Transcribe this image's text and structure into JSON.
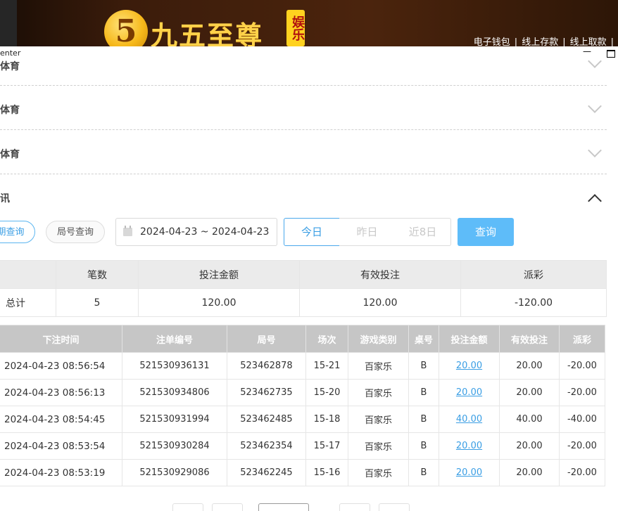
{
  "banner": {
    "logo_glyph": "5",
    "logo_text": "九五至尊",
    "logo_tag": "娱乐",
    "links": [
      "电子钱包",
      "线上存款",
      "线上取款"
    ],
    "separator": "|"
  },
  "window": {
    "title": "enter",
    "minimize_glyph": "—"
  },
  "accordion": [
    {
      "label": "体育",
      "expanded": false
    },
    {
      "label": "体育",
      "expanded": false
    },
    {
      "label": "体育",
      "expanded": false
    },
    {
      "label": "讯",
      "expanded": true
    }
  ],
  "query": {
    "mode_date": "期查询",
    "mode_round": "局号查询",
    "date_range": "2024-04-23 ~ 2024-04-23",
    "today": "今日",
    "yesterday": "昨日",
    "last8": "近8日",
    "submit": "查询"
  },
  "summary": {
    "headers": [
      "",
      "笔数",
      "投注金额",
      "有效投注",
      "派彩"
    ],
    "row": [
      "总计",
      "5",
      "120.00",
      "120.00",
      "-120.00"
    ]
  },
  "details": {
    "headers": [
      "下注时间",
      "注单编号",
      "局号",
      "场次",
      "游戏类别",
      "桌号",
      "投注金额",
      "有效投注",
      "派彩"
    ],
    "rows": [
      [
        "2024-04-23 08:56:54",
        "521530936131",
        "523462878",
        "15-21",
        "百家乐",
        "B",
        "20.00",
        "20.00",
        "-20.00"
      ],
      [
        "2024-04-23 08:56:13",
        "521530934806",
        "523462735",
        "15-20",
        "百家乐",
        "B",
        "20.00",
        "20.00",
        "-20.00"
      ],
      [
        "2024-04-23 08:54:45",
        "521530931994",
        "523462485",
        "15-18",
        "百家乐",
        "B",
        "40.00",
        "40.00",
        "-40.00"
      ],
      [
        "2024-04-23 08:53:54",
        "521530930284",
        "523462354",
        "15-17",
        "百家乐",
        "B",
        "20.00",
        "20.00",
        "-20.00"
      ],
      [
        "2024-04-23 08:53:19",
        "521530929086",
        "523462245",
        "15-16",
        "百家乐",
        "B",
        "20.00",
        "20.00",
        "-20.00"
      ]
    ]
  },
  "colors": {
    "accent": "#3a9ee4",
    "negative": "#e8485c",
    "query_button": "#5ebcf9"
  }
}
